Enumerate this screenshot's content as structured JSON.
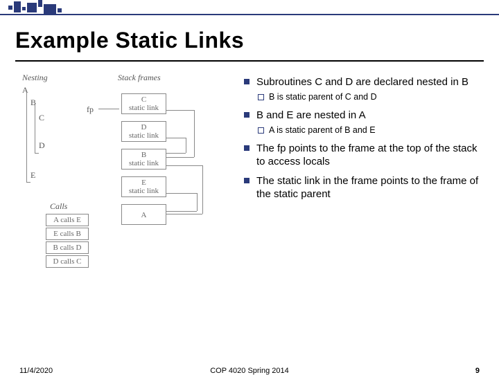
{
  "header": {
    "title": "Example Static Links"
  },
  "diagram": {
    "nesting_label": "Nesting",
    "stackframes_label": "Stack frames",
    "calls_label": "Calls",
    "fp_label": "fp",
    "nest_A": "A",
    "nest_B": "B",
    "nest_C": "C",
    "nest_D": "D",
    "nest_E": "E",
    "frame_C": "C",
    "frame_C_link": "static link",
    "frame_D": "D",
    "frame_D_link": "static link",
    "frame_B": "B",
    "frame_B_link": "static link",
    "frame_E": "E",
    "frame_E_link": "static link",
    "frame_A": "A",
    "call1": "A calls E",
    "call2": "E calls B",
    "call3": "B calls D",
    "call4": "D calls C"
  },
  "bullets": {
    "b1": "Subroutines C and D are declared nested in B",
    "b1s1": "B is static parent of C and D",
    "b2": "B and E are nested in A",
    "b2s1": "A is static parent of B and E",
    "b3": "The fp points to the frame at the top of the stack to access locals",
    "b4": "The static link in the frame points to the frame of the static parent"
  },
  "footer": {
    "date": "11/4/2020",
    "course": "COP 4020 Spring 2014",
    "page": "9"
  }
}
